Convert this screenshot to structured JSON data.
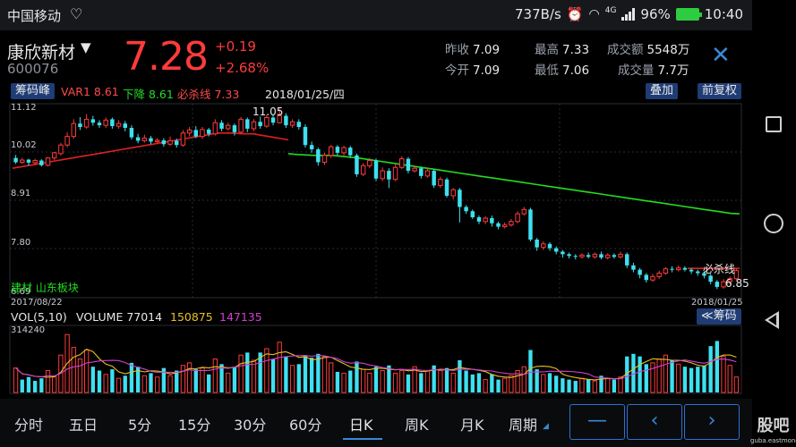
{
  "status_bar": {
    "carrier": "中国移动",
    "speed": "737B/s",
    "network": "4G",
    "battery": "96%",
    "time": "10:40",
    "icons": [
      "heart-icon",
      "alarm-icon",
      "wifi-icon",
      "signal-icon",
      "battery-icon"
    ]
  },
  "stock": {
    "name": "康欣新材",
    "code": "600076",
    "price": "7.28",
    "change": "+0.19",
    "change_pct": "+2.68%",
    "stats": [
      {
        "label": "昨收",
        "value": "7.09"
      },
      {
        "label": "今开",
        "value": "7.09"
      },
      {
        "label": "最高",
        "value": "7.33"
      },
      {
        "label": "最低",
        "value": "7.06"
      },
      {
        "label": "成交额",
        "value": "5548万"
      },
      {
        "label": "成交量",
        "value": "7.7万"
      }
    ]
  },
  "indicator": {
    "chip_button": "筹码峰",
    "var1": "VAR1 8.61",
    "down": "下降 8.61",
    "must_kill": "必杀线 7.33",
    "date": "2018/01/25/四",
    "overlay_button": "叠加",
    "fq_button": "前复权"
  },
  "kline": {
    "y_labels": [
      "11.12",
      "10.02",
      "8.91",
      "7.80",
      "6.69"
    ],
    "high_marker": "11.05",
    "low_marker": "6.85",
    "start_date": "2017/08/22",
    "end_date": "2018/01/25",
    "sector": "建材  山东板块",
    "must_kill_label": "必杀线"
  },
  "volume": {
    "title": "VOL(5,10)",
    "volume": "VOLUME 77014",
    "ma5": "150875",
    "ma10": "147135",
    "max_label": "314240",
    "chip_button": "≪筹码"
  },
  "tabs": [
    "分时",
    "五日",
    "5分",
    "15分",
    "30分",
    "60分",
    "日K",
    "周K",
    "月K",
    "周期"
  ],
  "active_tab": "日K",
  "nav_buttons": {
    "minus": "—",
    "prev": "‹",
    "next": "›"
  },
  "watermark": {
    "main": "股吧",
    "sub": "guba.eastmoney.com"
  },
  "colors": {
    "up": "#ff3b3b",
    "down": "#3ee0f0",
    "ma_red": "#e02020",
    "ma_green": "#22dd22",
    "vol_ma5": "#e8c020",
    "vol_ma10": "#d040d0",
    "accent": "#3a88d8"
  },
  "chart_data": {
    "type": "candlestick",
    "ylim": [
      6.69,
      11.12
    ],
    "candles": [
      [
        9.9,
        9.8,
        9.97,
        9.76
      ],
      [
        9.8,
        9.85,
        9.9,
        9.76
      ],
      [
        9.86,
        9.79,
        9.88,
        9.72
      ],
      [
        9.79,
        9.84,
        9.88,
        9.73
      ],
      [
        9.84,
        9.73,
        9.87,
        9.7
      ],
      [
        9.73,
        9.9,
        9.92,
        9.7
      ],
      [
        9.9,
        10.02,
        10.04,
        9.85
      ],
      [
        10.0,
        10.2,
        10.25,
        9.96
      ],
      [
        10.2,
        10.4,
        10.5,
        10.15
      ],
      [
        10.4,
        10.7,
        10.8,
        10.35
      ],
      [
        10.7,
        10.62,
        10.85,
        10.55
      ],
      [
        10.62,
        10.8,
        10.92,
        10.58
      ],
      [
        10.8,
        10.72,
        10.88,
        10.65
      ],
      [
        10.72,
        10.66,
        10.78,
        10.6
      ],
      [
        10.66,
        10.78,
        10.84,
        10.6
      ],
      [
        10.8,
        10.64,
        10.84,
        10.58
      ],
      [
        10.64,
        10.7,
        10.78,
        10.58
      ],
      [
        10.7,
        10.6,
        10.76,
        10.52
      ],
      [
        10.6,
        10.38,
        10.66,
        10.33
      ],
      [
        10.38,
        10.3,
        10.46,
        10.24
      ],
      [
        10.3,
        10.36,
        10.44,
        10.26
      ],
      [
        10.36,
        10.28,
        10.41,
        10.22
      ],
      [
        10.28,
        10.31,
        10.36,
        10.24
      ],
      [
        10.31,
        10.22,
        10.36,
        10.16
      ],
      [
        10.22,
        10.3,
        10.4,
        10.18
      ],
      [
        10.3,
        10.2,
        10.35,
        10.14
      ],
      [
        10.2,
        10.48,
        10.55,
        10.16
      ],
      [
        10.48,
        10.55,
        10.62,
        10.4
      ],
      [
        10.55,
        10.4,
        10.64,
        10.36
      ],
      [
        10.4,
        10.56,
        10.62,
        10.34
      ],
      [
        10.56,
        10.46,
        10.6,
        10.4
      ],
      [
        10.46,
        10.72,
        10.8,
        10.42
      ],
      [
        10.72,
        10.58,
        10.78,
        10.52
      ],
      [
        10.58,
        10.66,
        10.72,
        10.54
      ],
      [
        10.66,
        10.5,
        10.7,
        10.42
      ],
      [
        10.5,
        10.8,
        10.85,
        10.46
      ],
      [
        10.8,
        10.58,
        10.84,
        10.5
      ],
      [
        10.58,
        10.74,
        10.8,
        10.52
      ],
      [
        10.74,
        10.64,
        10.86,
        10.58
      ],
      [
        10.64,
        10.84,
        10.9,
        10.6
      ],
      [
        10.84,
        10.72,
        10.9,
        10.66
      ],
      [
        10.72,
        10.88,
        11.05,
        10.7
      ],
      [
        10.88,
        10.66,
        10.94,
        10.6
      ],
      [
        10.66,
        10.74,
        10.8,
        10.6
      ],
      [
        10.74,
        10.62,
        10.8,
        10.56
      ],
      [
        10.62,
        10.2,
        10.68,
        10.14
      ],
      [
        10.2,
        10.1,
        10.28,
        10.02
      ],
      [
        10.1,
        9.8,
        10.14,
        9.72
      ],
      [
        9.8,
        9.96,
        10.02,
        9.74
      ],
      [
        9.96,
        10.16,
        10.2,
        9.9
      ],
      [
        10.16,
        10.02,
        10.2,
        9.96
      ],
      [
        10.02,
        10.14,
        10.18,
        9.96
      ],
      [
        10.14,
        9.96,
        10.18,
        9.9
      ],
      [
        9.96,
        9.52,
        10.0,
        9.46
      ],
      [
        9.52,
        9.72,
        9.78,
        9.48
      ],
      [
        9.72,
        9.84,
        9.9,
        9.66
      ],
      [
        9.84,
        9.42,
        9.88,
        9.36
      ],
      [
        9.42,
        9.6,
        9.68,
        9.36
      ],
      [
        9.6,
        9.4,
        9.66,
        9.2
      ],
      [
        9.4,
        9.68,
        9.74,
        9.36
      ],
      [
        9.68,
        9.88,
        9.94,
        9.64
      ],
      [
        9.88,
        9.6,
        9.92,
        9.54
      ],
      [
        9.6,
        9.66,
        9.72,
        9.56
      ],
      [
        9.66,
        9.48,
        9.7,
        9.42
      ],
      [
        9.48,
        9.6,
        9.66,
        9.44
      ],
      [
        9.6,
        9.26,
        9.64,
        9.2
      ],
      [
        9.26,
        9.4,
        9.46,
        9.2
      ],
      [
        9.4,
        9.02,
        9.44,
        8.98
      ],
      [
        9.02,
        9.16,
        9.2,
        8.94
      ],
      [
        9.16,
        8.76,
        9.2,
        8.4
      ],
      [
        8.76,
        8.66,
        8.8,
        8.6
      ],
      [
        8.66,
        8.52,
        8.7,
        8.48
      ],
      [
        8.52,
        8.42,
        8.56,
        8.36
      ],
      [
        8.42,
        8.5,
        8.54,
        8.36
      ],
      [
        8.5,
        8.38,
        8.56,
        8.3
      ],
      [
        8.38,
        8.3,
        8.42,
        8.24
      ],
      [
        8.3,
        8.34,
        8.4,
        8.26
      ],
      [
        8.34,
        8.42,
        8.48,
        8.3
      ],
      [
        8.42,
        8.6,
        8.66,
        8.38
      ],
      [
        8.6,
        8.7,
        8.76,
        8.56
      ],
      [
        8.7,
        8.0,
        8.74,
        7.96
      ],
      [
        8.0,
        7.82,
        8.04,
        7.74
      ],
      [
        7.82,
        7.9,
        7.96,
        7.76
      ],
      [
        7.9,
        7.8,
        7.94,
        7.74
      ],
      [
        7.8,
        7.72,
        7.84,
        7.66
      ],
      [
        7.72,
        7.66,
        7.76,
        7.58
      ],
      [
        7.66,
        7.62,
        7.7,
        7.56
      ],
      [
        7.62,
        7.6,
        7.66,
        7.54
      ],
      [
        7.6,
        7.64,
        7.68,
        7.56
      ],
      [
        7.64,
        7.6,
        7.7,
        7.56
      ],
      [
        7.6,
        7.66,
        7.7,
        7.56
      ],
      [
        7.66,
        7.58,
        7.72,
        7.54
      ],
      [
        7.58,
        7.64,
        7.68,
        7.54
      ],
      [
        7.64,
        7.6,
        7.68,
        7.56
      ],
      [
        7.6,
        7.66,
        7.72,
        7.56
      ],
      [
        7.66,
        7.4,
        7.7,
        7.34
      ],
      [
        7.4,
        7.3,
        7.46,
        7.24
      ],
      [
        7.3,
        7.18,
        7.34,
        7.1
      ],
      [
        7.18,
        7.06,
        7.22,
        7.0
      ],
      [
        7.06,
        7.14,
        7.2,
        7.02
      ],
      [
        7.14,
        7.22,
        7.28,
        7.08
      ],
      [
        7.22,
        7.32,
        7.36,
        7.18
      ],
      [
        7.32,
        7.3,
        7.38,
        7.24
      ],
      [
        7.3,
        7.34,
        7.4,
        7.26
      ],
      [
        7.34,
        7.3,
        7.38,
        7.26
      ],
      [
        7.3,
        7.26,
        7.34,
        7.2
      ],
      [
        7.26,
        7.22,
        7.3,
        7.16
      ],
      [
        7.22,
        7.16,
        7.26,
        7.1
      ],
      [
        7.16,
        7.02,
        7.2,
        6.96
      ],
      [
        7.02,
        6.9,
        7.06,
        6.85
      ],
      [
        6.9,
        7.02,
        7.08,
        6.86
      ],
      [
        7.02,
        7.09,
        7.14,
        6.96
      ],
      [
        7.09,
        7.28,
        7.33,
        7.06
      ]
    ],
    "ma_red": [
      9.66,
      9.68,
      9.7,
      9.72,
      9.74,
      9.76,
      9.78,
      9.8,
      9.82,
      9.84,
      9.86,
      9.88,
      9.9,
      9.92,
      9.94,
      9.96,
      9.98,
      10.0,
      10.02,
      10.04,
      10.06,
      10.08,
      10.1,
      10.12,
      10.14,
      10.16,
      10.18,
      10.2,
      10.22,
      10.24,
      10.26,
      10.28,
      10.3,
      10.32,
      10.34,
      10.36,
      10.38,
      10.4,
      10.42,
      10.44,
      10.46,
      10.48,
      10.48,
      10.48,
      10.48,
      10.47,
      10.46,
      10.46,
      10.46,
      10.44,
      10.42,
      10.4,
      10.38,
      10.36,
      10.34,
      10.32
    ],
    "ma_green": [
      10.0,
      9.98,
      9.97,
      9.96,
      9.96,
      9.96,
      9.94,
      9.92,
      9.9,
      9.87,
      9.84,
      9.81,
      9.78,
      9.75,
      9.72,
      9.69,
      9.66,
      9.63,
      9.6,
      9.57,
      9.54,
      9.51,
      9.48,
      9.45,
      9.42,
      9.39,
      9.36,
      9.33,
      9.3,
      9.27,
      9.24,
      9.21,
      9.18,
      9.15,
      9.12,
      9.09,
      9.06,
      9.03,
      9.0,
      8.97,
      8.94,
      8.91,
      8.88,
      8.85,
      8.82,
      8.79,
      8.76,
      8.73,
      8.7,
      8.67,
      8.64,
      8.61,
      8.6
    ],
    "volume_ylim": [
      0,
      314240
    ],
    "volumes": [
      [
        0.38,
        0
      ],
      [
        0.2,
        1
      ],
      [
        0.24,
        1
      ],
      [
        0.18,
        1
      ],
      [
        0.22,
        1
      ],
      [
        0.34,
        0
      ],
      [
        0.24,
        0
      ],
      [
        0.58,
        0
      ],
      [
        0.9,
        0
      ],
      [
        0.7,
        0
      ],
      [
        0.52,
        0
      ],
      [
        0.66,
        0
      ],
      [
        0.4,
        1
      ],
      [
        0.34,
        1
      ],
      [
        0.28,
        0
      ],
      [
        0.36,
        1
      ],
      [
        0.22,
        0
      ],
      [
        0.26,
        1
      ],
      [
        0.46,
        1
      ],
      [
        0.4,
        1
      ],
      [
        0.26,
        0
      ],
      [
        0.3,
        1
      ],
      [
        0.24,
        0
      ],
      [
        0.38,
        1
      ],
      [
        0.26,
        0
      ],
      [
        0.34,
        1
      ],
      [
        0.42,
        0
      ],
      [
        0.46,
        0
      ],
      [
        0.36,
        1
      ],
      [
        0.38,
        0
      ],
      [
        0.28,
        1
      ],
      [
        0.52,
        0
      ],
      [
        0.44,
        1
      ],
      [
        0.3,
        0
      ],
      [
        0.4,
        1
      ],
      [
        0.58,
        0
      ],
      [
        0.62,
        1
      ],
      [
        0.5,
        0
      ],
      [
        0.62,
        1
      ],
      [
        0.68,
        0
      ],
      [
        0.52,
        1
      ],
      [
        0.78,
        0
      ],
      [
        0.56,
        1
      ],
      [
        0.42,
        0
      ],
      [
        0.44,
        1
      ],
      [
        0.58,
        1
      ],
      [
        0.54,
        1
      ],
      [
        0.6,
        1
      ],
      [
        0.56,
        0
      ],
      [
        0.46,
        0
      ],
      [
        0.32,
        1
      ],
      [
        0.3,
        0
      ],
      [
        0.34,
        1
      ],
      [
        0.48,
        1
      ],
      [
        0.36,
        0
      ],
      [
        0.3,
        0
      ],
      [
        0.4,
        1
      ],
      [
        0.34,
        0
      ],
      [
        0.42,
        1
      ],
      [
        0.3,
        0
      ],
      [
        0.34,
        0
      ],
      [
        0.28,
        1
      ],
      [
        0.4,
        0
      ],
      [
        0.3,
        1
      ],
      [
        0.34,
        0
      ],
      [
        0.42,
        1
      ],
      [
        0.34,
        0
      ],
      [
        0.38,
        1
      ],
      [
        0.3,
        0
      ],
      [
        0.5,
        1
      ],
      [
        0.34,
        1
      ],
      [
        0.28,
        1
      ],
      [
        0.3,
        1
      ],
      [
        0.2,
        0
      ],
      [
        0.28,
        1
      ],
      [
        0.2,
        1
      ],
      [
        0.22,
        0
      ],
      [
        0.26,
        0
      ],
      [
        0.34,
        0
      ],
      [
        0.4,
        0
      ],
      [
        0.66,
        1
      ],
      [
        0.36,
        1
      ],
      [
        0.28,
        0
      ],
      [
        0.3,
        1
      ],
      [
        0.26,
        1
      ],
      [
        0.22,
        1
      ],
      [
        0.2,
        1
      ],
      [
        0.18,
        1
      ],
      [
        0.22,
        0
      ],
      [
        0.2,
        1
      ],
      [
        0.18,
        0
      ],
      [
        0.26,
        1
      ],
      [
        0.22,
        0
      ],
      [
        0.2,
        1
      ],
      [
        0.24,
        0
      ],
      [
        0.56,
        1
      ],
      [
        0.6,
        1
      ],
      [
        0.56,
        1
      ],
      [
        0.44,
        1
      ],
      [
        0.46,
        0
      ],
      [
        0.52,
        0
      ],
      [
        0.58,
        0
      ],
      [
        0.5,
        1
      ],
      [
        0.44,
        0
      ],
      [
        0.4,
        1
      ],
      [
        0.38,
        1
      ],
      [
        0.4,
        1
      ],
      [
        0.42,
        1
      ],
      [
        0.72,
        1
      ],
      [
        0.8,
        1
      ],
      [
        0.56,
        0
      ],
      [
        0.42,
        0
      ],
      [
        0.24,
        0
      ]
    ]
  }
}
